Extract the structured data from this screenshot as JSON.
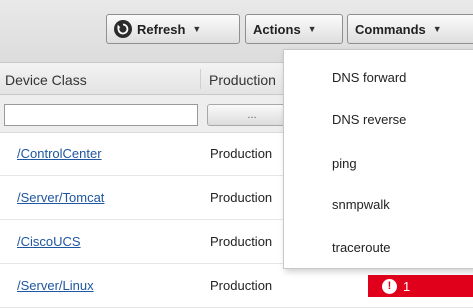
{
  "toolbar": {
    "refresh_label": "Refresh",
    "actions_label": "Actions",
    "commands_label": "Commands",
    "refresh_icon": "refresh-icon",
    "caret_icon": "chevron-down-icon"
  },
  "grid": {
    "columns": [
      "Device Class",
      "Production"
    ],
    "filter": {
      "device_class_value": "",
      "production_button_label": "..."
    },
    "rows": [
      {
        "device_class": "/ControlCenter",
        "production": "Production"
      },
      {
        "device_class": "/Server/Tomcat",
        "production": "Production"
      },
      {
        "device_class": "/CiscoUCS",
        "production": "Production"
      },
      {
        "device_class": "/Server/Linux",
        "production": "Production",
        "event_count": "1"
      }
    ]
  },
  "commands_menu": {
    "items": [
      "DNS forward",
      "DNS reverse",
      "ping",
      "snmpwalk",
      "traceroute"
    ]
  },
  "colors": {
    "link": "#1e56a0",
    "critical": "#e0001b"
  }
}
